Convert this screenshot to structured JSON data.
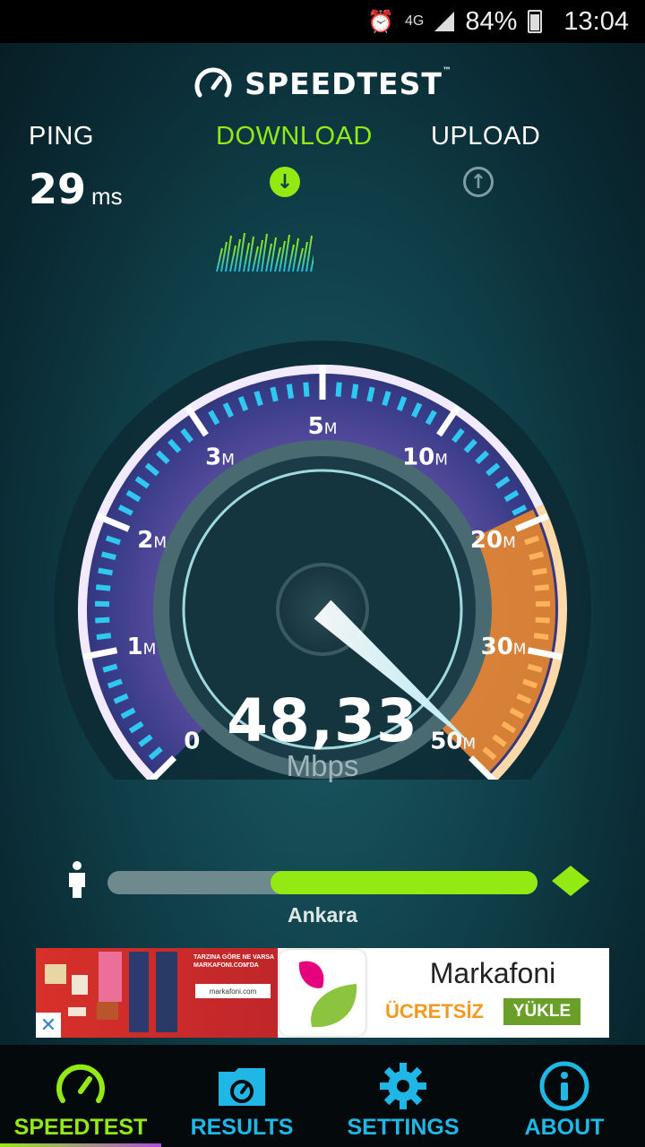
{
  "status_bar": {
    "network": "4G",
    "battery": "84%",
    "time": "13:04"
  },
  "app": {
    "logo_text": "SPEEDTEST",
    "trademark": "™"
  },
  "metrics": {
    "ping_label": "PING",
    "ping_value": "29",
    "ping_unit": "ms",
    "download_label": "DOWNLOAD",
    "upload_label": "UPLOAD"
  },
  "gauge": {
    "ticks": [
      "0",
      "1M",
      "2M",
      "3M",
      "5M",
      "10M",
      "20M",
      "30M",
      "50M"
    ],
    "speed_value": "48,33",
    "speed_unit": "Mbps",
    "needle_mbps": 48.33
  },
  "server": {
    "name": "Ankara"
  },
  "ad": {
    "image_text": "TARZINA GÖRE NE VARSA MARKAFONI.COM'DA",
    "image_brand": "markafoni.com",
    "title": "Markafoni",
    "price": "ÜCRETSİZ",
    "install": "YÜKLE"
  },
  "nav": [
    {
      "label": "SPEEDTEST",
      "icon": "speedometer-icon",
      "active": true
    },
    {
      "label": "RESULTS",
      "icon": "results-folder-icon",
      "active": false
    },
    {
      "label": "SETTINGS",
      "icon": "gear-icon",
      "active": false
    },
    {
      "label": "ABOUT",
      "icon": "info-icon",
      "active": false
    }
  ],
  "colors": {
    "accent_green": "#93ea12",
    "accent_cyan": "#1fb7e6",
    "accent_orange": "#f0902a",
    "active_nav": "#93ea12",
    "inactive_nav": "#1fb7e6"
  }
}
